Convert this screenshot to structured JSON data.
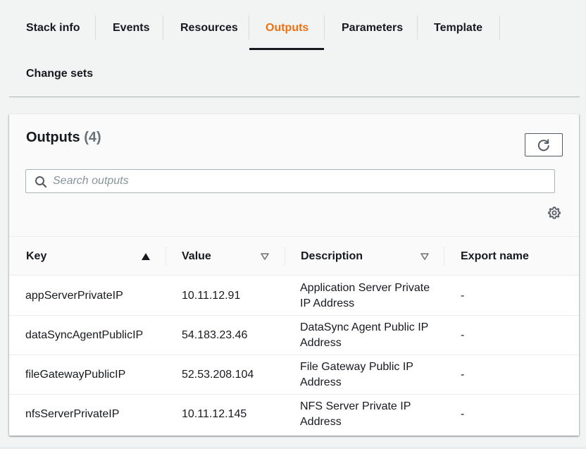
{
  "tabs": [
    {
      "label": "Stack info",
      "active": false
    },
    {
      "label": "Events",
      "active": false
    },
    {
      "label": "Resources",
      "active": false
    },
    {
      "label": "Outputs",
      "active": true
    },
    {
      "label": "Parameters",
      "active": false
    },
    {
      "label": "Template",
      "active": false
    },
    {
      "label": "Change sets",
      "active": false
    }
  ],
  "panel": {
    "title": "Outputs",
    "count": "(4)",
    "refresh_icon": "refresh-icon",
    "search_placeholder": "Search outputs",
    "search_value": "",
    "settings_icon": "gear-icon"
  },
  "table": {
    "columns": [
      {
        "label": "Key",
        "sort": "ascending"
      },
      {
        "label": "Value",
        "sort": "sortable"
      },
      {
        "label": "Description",
        "sort": "sortable"
      },
      {
        "label": "Export name",
        "sort": "none"
      }
    ],
    "rows": [
      {
        "key": "appServerPrivateIP",
        "value": "10.11.12.91",
        "description": "Application Server Private IP Address",
        "export_name": "-"
      },
      {
        "key": "dataSyncAgentPublicIP",
        "value": "54.183.23.46",
        "description": "DataSync Agent Public IP Address",
        "export_name": "-"
      },
      {
        "key": "fileGatewayPublicIP",
        "value": "52.53.208.104",
        "description": "File Gateway Public IP Address",
        "export_name": "-"
      },
      {
        "key": "nfsServerPrivateIP",
        "value": "10.11.12.145",
        "description": "NFS Server Private IP Address",
        "export_name": "-"
      }
    ]
  },
  "colors": {
    "accent": "#ec7211",
    "text": "#16191f",
    "muted": "#687078",
    "border": "#aab7b8"
  }
}
